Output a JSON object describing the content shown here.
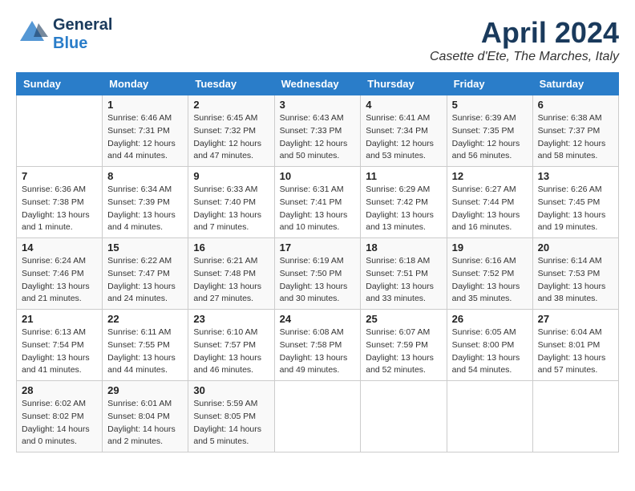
{
  "header": {
    "logo_general": "General",
    "logo_blue": "Blue",
    "month_title": "April 2024",
    "location": "Casette d'Ete, The Marches, Italy"
  },
  "days_of_week": [
    "Sunday",
    "Monday",
    "Tuesday",
    "Wednesday",
    "Thursday",
    "Friday",
    "Saturday"
  ],
  "weeks": [
    [
      {
        "day": "",
        "info": ""
      },
      {
        "day": "1",
        "info": "Sunrise: 6:46 AM\nSunset: 7:31 PM\nDaylight: 12 hours\nand 44 minutes."
      },
      {
        "day": "2",
        "info": "Sunrise: 6:45 AM\nSunset: 7:32 PM\nDaylight: 12 hours\nand 47 minutes."
      },
      {
        "day": "3",
        "info": "Sunrise: 6:43 AM\nSunset: 7:33 PM\nDaylight: 12 hours\nand 50 minutes."
      },
      {
        "day": "4",
        "info": "Sunrise: 6:41 AM\nSunset: 7:34 PM\nDaylight: 12 hours\nand 53 minutes."
      },
      {
        "day": "5",
        "info": "Sunrise: 6:39 AM\nSunset: 7:35 PM\nDaylight: 12 hours\nand 56 minutes."
      },
      {
        "day": "6",
        "info": "Sunrise: 6:38 AM\nSunset: 7:37 PM\nDaylight: 12 hours\nand 58 minutes."
      }
    ],
    [
      {
        "day": "7",
        "info": "Sunrise: 6:36 AM\nSunset: 7:38 PM\nDaylight: 13 hours\nand 1 minute."
      },
      {
        "day": "8",
        "info": "Sunrise: 6:34 AM\nSunset: 7:39 PM\nDaylight: 13 hours\nand 4 minutes."
      },
      {
        "day": "9",
        "info": "Sunrise: 6:33 AM\nSunset: 7:40 PM\nDaylight: 13 hours\nand 7 minutes."
      },
      {
        "day": "10",
        "info": "Sunrise: 6:31 AM\nSunset: 7:41 PM\nDaylight: 13 hours\nand 10 minutes."
      },
      {
        "day": "11",
        "info": "Sunrise: 6:29 AM\nSunset: 7:42 PM\nDaylight: 13 hours\nand 13 minutes."
      },
      {
        "day": "12",
        "info": "Sunrise: 6:27 AM\nSunset: 7:44 PM\nDaylight: 13 hours\nand 16 minutes."
      },
      {
        "day": "13",
        "info": "Sunrise: 6:26 AM\nSunset: 7:45 PM\nDaylight: 13 hours\nand 19 minutes."
      }
    ],
    [
      {
        "day": "14",
        "info": "Sunrise: 6:24 AM\nSunset: 7:46 PM\nDaylight: 13 hours\nand 21 minutes."
      },
      {
        "day": "15",
        "info": "Sunrise: 6:22 AM\nSunset: 7:47 PM\nDaylight: 13 hours\nand 24 minutes."
      },
      {
        "day": "16",
        "info": "Sunrise: 6:21 AM\nSunset: 7:48 PM\nDaylight: 13 hours\nand 27 minutes."
      },
      {
        "day": "17",
        "info": "Sunrise: 6:19 AM\nSunset: 7:50 PM\nDaylight: 13 hours\nand 30 minutes."
      },
      {
        "day": "18",
        "info": "Sunrise: 6:18 AM\nSunset: 7:51 PM\nDaylight: 13 hours\nand 33 minutes."
      },
      {
        "day": "19",
        "info": "Sunrise: 6:16 AM\nSunset: 7:52 PM\nDaylight: 13 hours\nand 35 minutes."
      },
      {
        "day": "20",
        "info": "Sunrise: 6:14 AM\nSunset: 7:53 PM\nDaylight: 13 hours\nand 38 minutes."
      }
    ],
    [
      {
        "day": "21",
        "info": "Sunrise: 6:13 AM\nSunset: 7:54 PM\nDaylight: 13 hours\nand 41 minutes."
      },
      {
        "day": "22",
        "info": "Sunrise: 6:11 AM\nSunset: 7:55 PM\nDaylight: 13 hours\nand 44 minutes."
      },
      {
        "day": "23",
        "info": "Sunrise: 6:10 AM\nSunset: 7:57 PM\nDaylight: 13 hours\nand 46 minutes."
      },
      {
        "day": "24",
        "info": "Sunrise: 6:08 AM\nSunset: 7:58 PM\nDaylight: 13 hours\nand 49 minutes."
      },
      {
        "day": "25",
        "info": "Sunrise: 6:07 AM\nSunset: 7:59 PM\nDaylight: 13 hours\nand 52 minutes."
      },
      {
        "day": "26",
        "info": "Sunrise: 6:05 AM\nSunset: 8:00 PM\nDaylight: 13 hours\nand 54 minutes."
      },
      {
        "day": "27",
        "info": "Sunrise: 6:04 AM\nSunset: 8:01 PM\nDaylight: 13 hours\nand 57 minutes."
      }
    ],
    [
      {
        "day": "28",
        "info": "Sunrise: 6:02 AM\nSunset: 8:02 PM\nDaylight: 14 hours\nand 0 minutes."
      },
      {
        "day": "29",
        "info": "Sunrise: 6:01 AM\nSunset: 8:04 PM\nDaylight: 14 hours\nand 2 minutes."
      },
      {
        "day": "30",
        "info": "Sunrise: 5:59 AM\nSunset: 8:05 PM\nDaylight: 14 hours\nand 5 minutes."
      },
      {
        "day": "",
        "info": ""
      },
      {
        "day": "",
        "info": ""
      },
      {
        "day": "",
        "info": ""
      },
      {
        "day": "",
        "info": ""
      }
    ]
  ]
}
